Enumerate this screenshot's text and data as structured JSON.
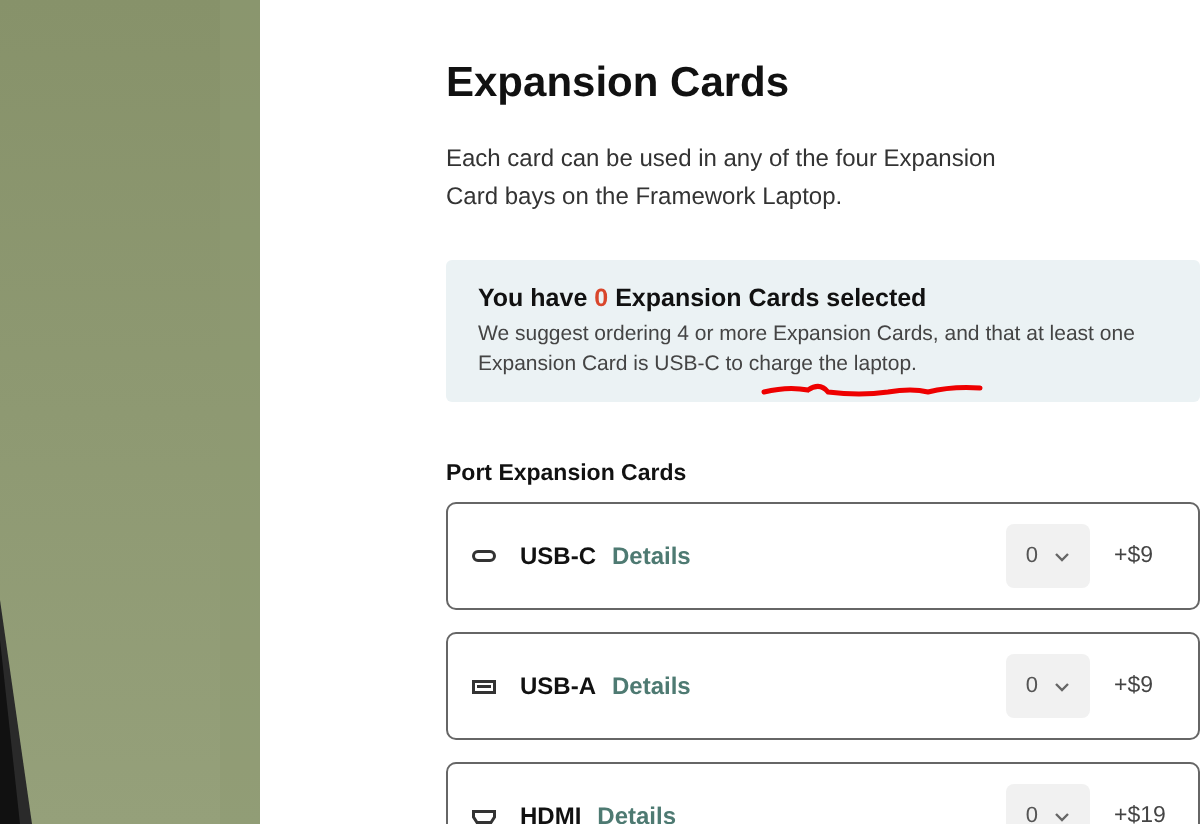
{
  "title": "Expansion Cards",
  "description": "Each card can be used in any of the four Expansion Card bays on the Framework Laptop.",
  "notice": {
    "lead": "You have",
    "count": "0",
    "tail": "Expansion Cards selected",
    "body": "We suggest ordering 4 or more Expansion Cards, and that at least one Expansion Card is USB-C to charge the laptop."
  },
  "section_title": "Port Expansion Cards",
  "cards": [
    {
      "kind": "usb-c",
      "name": "USB-C",
      "link": "Details",
      "quantity": "0",
      "price": "+$9"
    },
    {
      "kind": "usb-a",
      "name": "USB-A",
      "link": "Details",
      "quantity": "0",
      "price": "+$9"
    },
    {
      "kind": "hdmi",
      "name": "HDMI",
      "link": "Details",
      "quantity": "0",
      "price": "+$19"
    }
  ]
}
